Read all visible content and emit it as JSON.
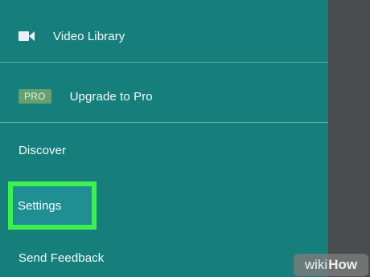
{
  "drawer": {
    "items": [
      {
        "id": "video-library",
        "label": "Video Library",
        "icon": "video-camera-icon"
      },
      {
        "id": "upgrade",
        "label": "Upgrade to Pro",
        "badge": "PRO"
      },
      {
        "id": "discover",
        "label": "Discover"
      },
      {
        "id": "settings",
        "label": "Settings",
        "highlighted": true
      },
      {
        "id": "send-feedback",
        "label": "Send Feedback"
      }
    ]
  },
  "watermark": {
    "prefix": "wiki",
    "suffix": "How"
  },
  "colors": {
    "drawer_background": "#167f7c",
    "highlight_border": "#3cf04e",
    "pro_badge": "#66a06f",
    "right_panel": "#4a4d4d"
  }
}
